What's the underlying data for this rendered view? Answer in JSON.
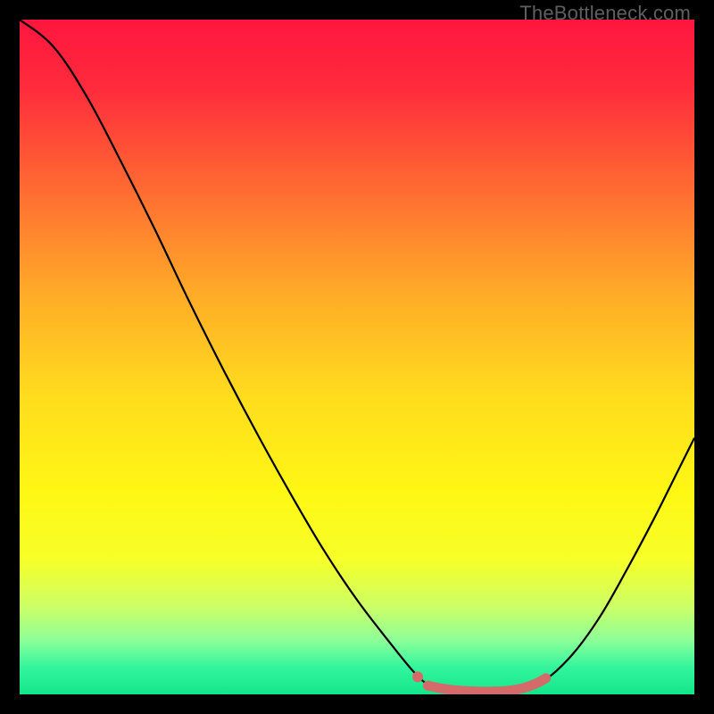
{
  "watermark": "TheBottleneck.com",
  "chart_data": {
    "type": "line",
    "title": "",
    "xlabel": "",
    "ylabel": "",
    "xlim": [
      0,
      100
    ],
    "ylim": [
      0,
      100
    ],
    "gradient_stops": [
      {
        "offset": 0.0,
        "color": "#ff163e"
      },
      {
        "offset": 0.1,
        "color": "#ff2b3c"
      },
      {
        "offset": 0.25,
        "color": "#ff6a32"
      },
      {
        "offset": 0.4,
        "color": "#ffa928"
      },
      {
        "offset": 0.55,
        "color": "#ffda1e"
      },
      {
        "offset": 0.7,
        "color": "#fff714"
      },
      {
        "offset": 0.8,
        "color": "#f6ff28"
      },
      {
        "offset": 0.87,
        "color": "#ccff66"
      },
      {
        "offset": 0.92,
        "color": "#8cff99"
      },
      {
        "offset": 0.96,
        "color": "#33f59d"
      },
      {
        "offset": 1.0,
        "color": "#15e68a"
      }
    ],
    "series": [
      {
        "name": "curve",
        "stroke": "#000000",
        "stroke_width": 2.2,
        "points": [
          {
            "x": 0.0,
            "y": 100.0
          },
          {
            "x": 5.0,
            "y": 96.0
          },
          {
            "x": 10.0,
            "y": 88.5
          },
          {
            "x": 15.0,
            "y": 79.0
          },
          {
            "x": 20.0,
            "y": 69.0
          },
          {
            "x": 25.0,
            "y": 58.5
          },
          {
            "x": 30.0,
            "y": 48.5
          },
          {
            "x": 35.0,
            "y": 39.0
          },
          {
            "x": 40.0,
            "y": 30.0
          },
          {
            "x": 45.0,
            "y": 21.5
          },
          {
            "x": 50.0,
            "y": 14.0
          },
          {
            "x": 55.0,
            "y": 7.5
          },
          {
            "x": 58.0,
            "y": 3.8
          },
          {
            "x": 60.0,
            "y": 1.8
          },
          {
            "x": 62.0,
            "y": 0.8
          },
          {
            "x": 65.0,
            "y": 0.3
          },
          {
            "x": 68.0,
            "y": 0.2
          },
          {
            "x": 72.0,
            "y": 0.3
          },
          {
            "x": 75.0,
            "y": 0.8
          },
          {
            "x": 78.0,
            "y": 2.2
          },
          {
            "x": 82.0,
            "y": 6.0
          },
          {
            "x": 86.0,
            "y": 11.5
          },
          {
            "x": 90.0,
            "y": 18.5
          },
          {
            "x": 94.0,
            "y": 26.0
          },
          {
            "x": 97.0,
            "y": 32.0
          },
          {
            "x": 100.0,
            "y": 38.0
          }
        ]
      },
      {
        "name": "highlight-band",
        "stroke": "#d46a6a",
        "stroke_width": 11,
        "linecap": "round",
        "points": [
          {
            "x": 60.5,
            "y": 1.3
          },
          {
            "x": 63.0,
            "y": 0.8
          },
          {
            "x": 66.0,
            "y": 0.5
          },
          {
            "x": 69.0,
            "y": 0.4
          },
          {
            "x": 72.0,
            "y": 0.5
          },
          {
            "x": 74.5,
            "y": 0.9
          },
          {
            "x": 76.5,
            "y": 1.6
          },
          {
            "x": 78.0,
            "y": 2.4
          }
        ]
      }
    ],
    "markers": [
      {
        "name": "highlight-dot",
        "x": 59.0,
        "y": 2.6,
        "r": 6,
        "fill": "#d46a6a"
      }
    ]
  }
}
